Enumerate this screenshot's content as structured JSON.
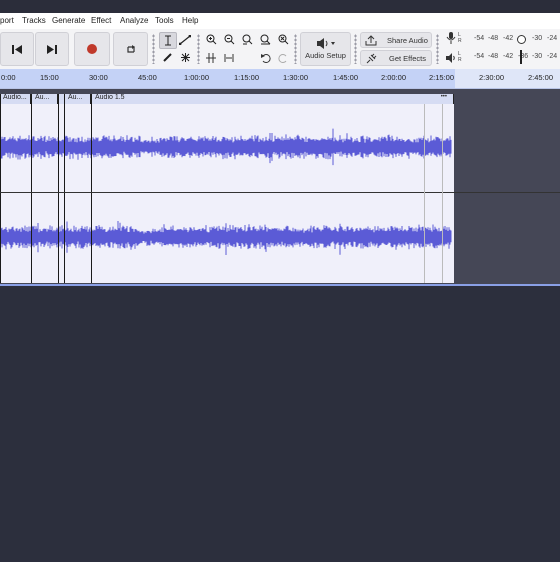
{
  "menu": {
    "items": [
      "port",
      "Tracks",
      "Generate",
      "Effect",
      "Analyze",
      "Tools",
      "Help"
    ]
  },
  "toolbar": {
    "audio_setup_label": "Audio Setup",
    "share_audio_label": "Share Audio",
    "get_effects_label": "Get Effects",
    "record_color": "#c0392b",
    "meter_rec_scale": [
      "-54",
      "-48",
      "-42",
      "-30",
      "-24"
    ],
    "meter_play_scale": [
      "-54",
      "-48",
      "-42",
      "-36",
      "-30",
      "-24"
    ],
    "meter_rec_letters": "L R",
    "meter_play_letters": "L R"
  },
  "timeline": {
    "ticks": [
      "0:00",
      "15:00",
      "30:00",
      "45:00",
      "1:00:00",
      "1:15:00",
      "1:30:00",
      "1:45:00",
      "2:00:00",
      "2:15:00",
      "2:30:00",
      "2:45:00"
    ]
  },
  "clips": [
    {
      "label": "Audio..."
    },
    {
      "label": "Au..."
    },
    {
      "label": ""
    },
    {
      "label": "Au..."
    },
    {
      "label": "Audio 1.5"
    }
  ],
  "clip_menu_glyph": "•••",
  "colors": {
    "waveform": "#5b5bd6",
    "track_bg": "#454756",
    "clip_bg": "#f0f0fa",
    "ruler_selection": "#c4d2f6",
    "empty_area": "#2c2f3d"
  }
}
